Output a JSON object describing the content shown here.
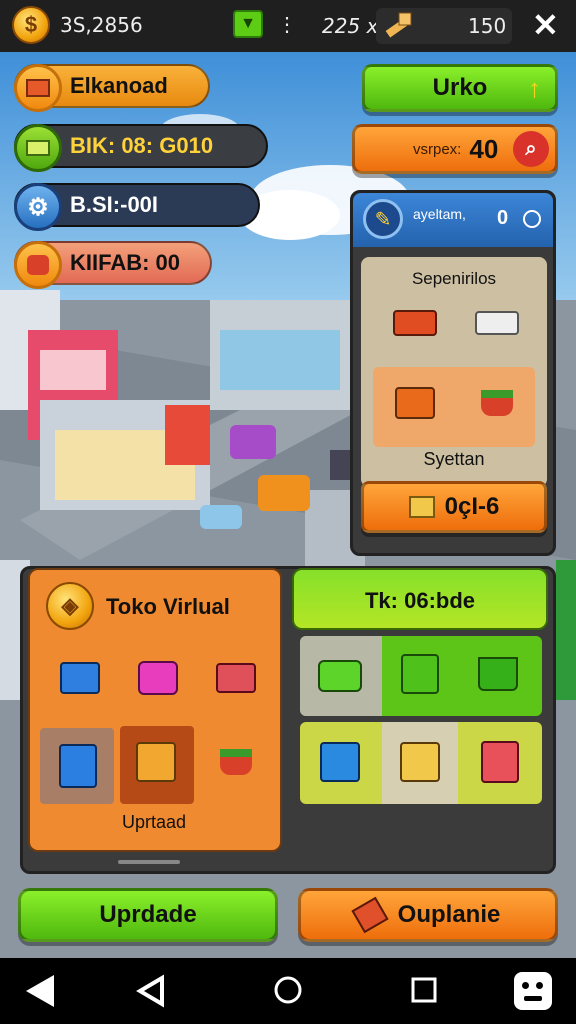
{
  "topbar": {
    "coins": "3S,2856",
    "gems": "225 x",
    "energy": "150",
    "coin_icon": "dollar-coin-icon",
    "gift_icon": "gift-icon",
    "more_icon": "more-vertical-icon",
    "close_icon": "close-icon"
  },
  "left_stats": [
    {
      "label": "Elkanoad",
      "icon": "crate-icon"
    },
    {
      "label": "BIK: 08: G010",
      "icon": "cash-icon"
    },
    {
      "label": "B.SI:-00I",
      "icon": "gear-icon"
    },
    {
      "label": "KIIFAB: 00",
      "icon": "hand-icon"
    }
  ],
  "right_top": {
    "urko_label": "Urko",
    "arrow_icon": "arrow-up-icon",
    "search_label": "vsrpex:",
    "search_value": "40",
    "search_icon": "search-icon"
  },
  "side_panel": {
    "header_label": "ayeltam,",
    "header_value": "0",
    "section1_title": "Sepenirilos",
    "section2_title": "Syettan",
    "footer_value": "0çI-6"
  },
  "shop_left": {
    "title": "Toko Virlual",
    "selected_label": "Uprtaad"
  },
  "shop_right": {
    "title": "Tk: 06:bde"
  },
  "buttons": {
    "upgrade": "Uprdade",
    "ouplanie": "Ouplanie"
  },
  "nav": {
    "back": "back-icon",
    "prev": "prev-icon",
    "home": "home-icon",
    "recents": "recents-icon",
    "assist": "assistant-icon"
  },
  "colors": {
    "green": "#5ccc14",
    "orange": "#f5821a",
    "panel_dark": "#3a3a3a"
  }
}
